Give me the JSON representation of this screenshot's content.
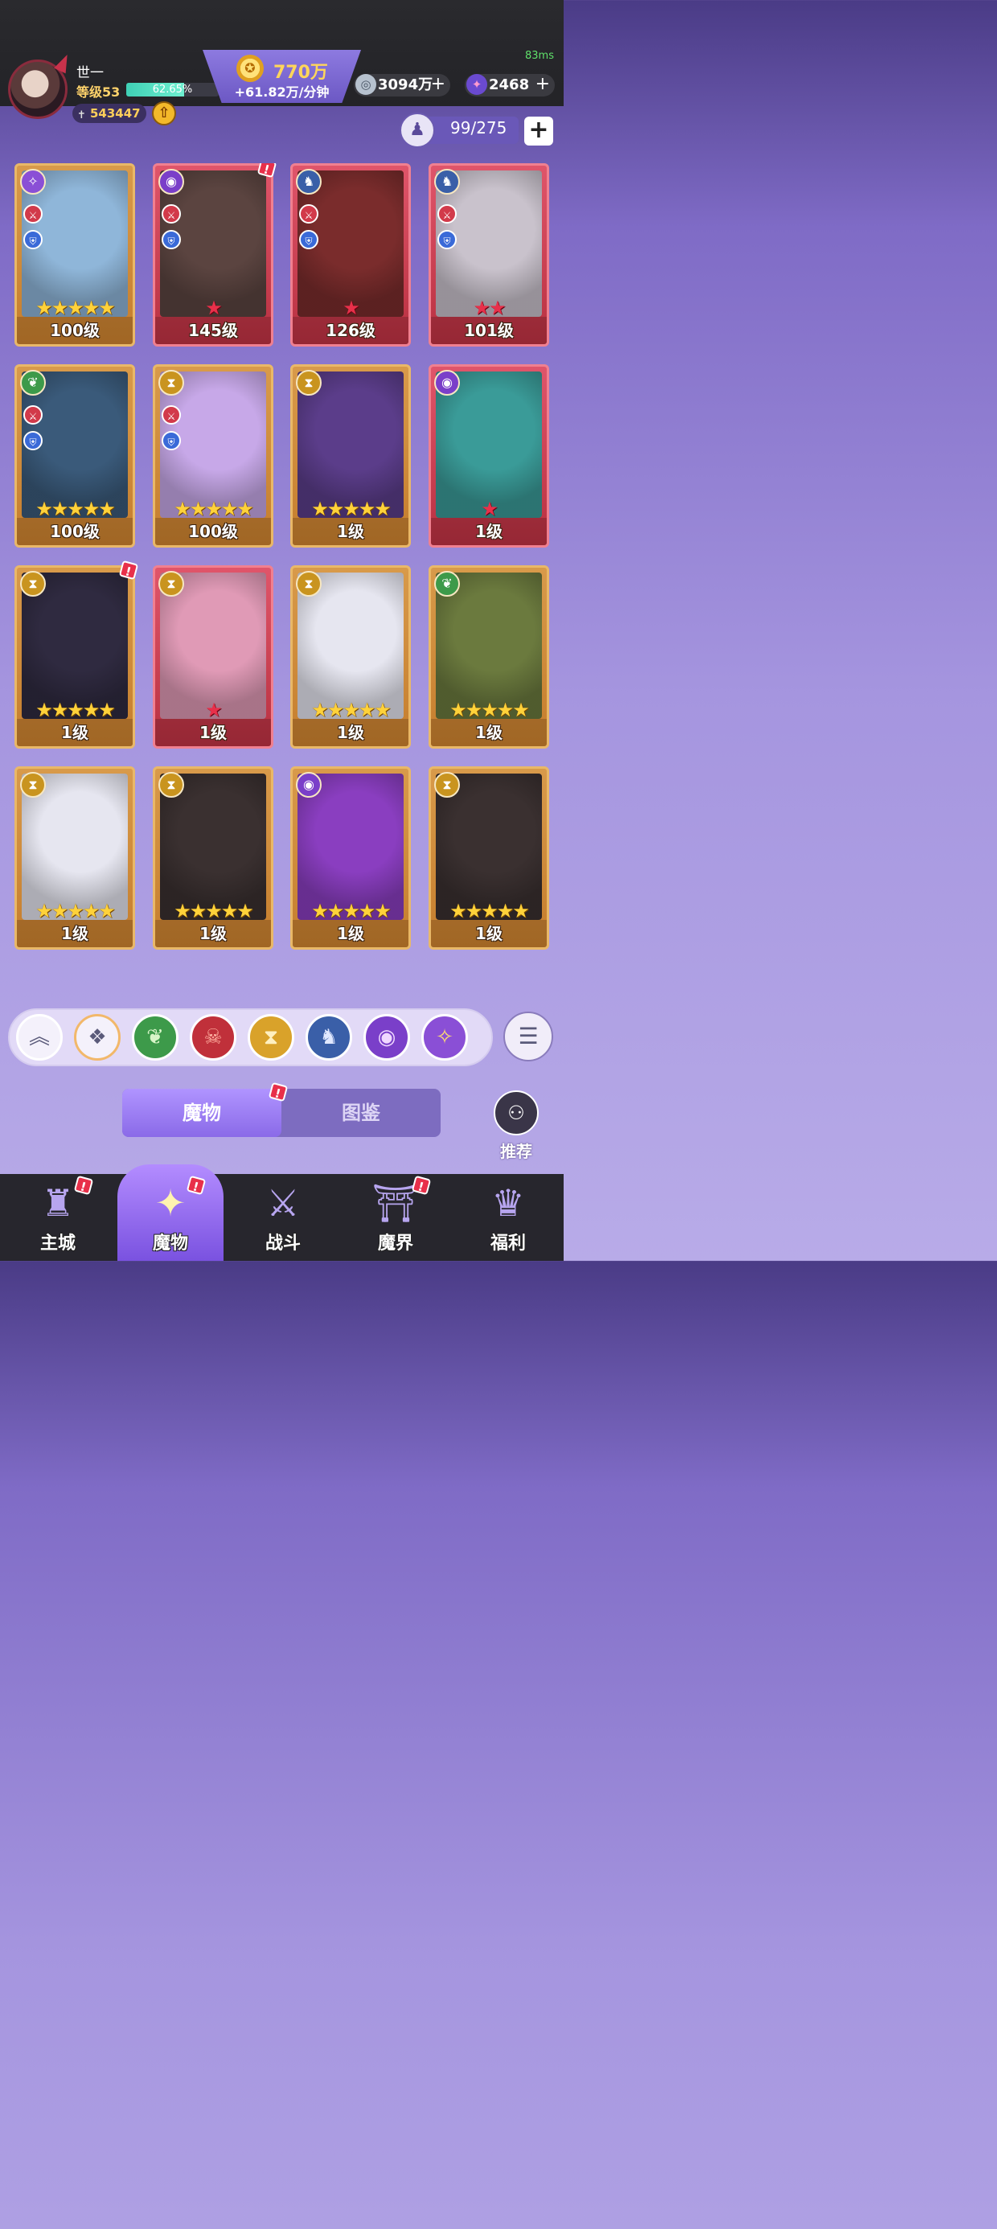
{
  "header": {
    "ping": "83ms",
    "player_name": "世一",
    "player_level": "等级53",
    "xp_percent_text": "62.65%",
    "xp_fraction": 0.6265,
    "power": "543447",
    "gold_amount": "770万",
    "gold_rate": "+61.82万/分钟",
    "currency1": "3094万",
    "currency2": "2468"
  },
  "capacity": {
    "text": "99/275"
  },
  "cards": [
    {
      "level": "100级",
      "frame": "gold",
      "stars": 5,
      "star_color": "gold",
      "element": "fairy",
      "element_color": "#8a4fd6",
      "atk": true,
      "def": true,
      "badge": false,
      "art": "#8fb6d9"
    },
    {
      "level": "145级",
      "frame": "red",
      "stars": 1,
      "star_color": "red",
      "element": "eye",
      "element_color": "#7a3fc9",
      "atk": true,
      "def": true,
      "badge": true,
      "art": "#5b4440"
    },
    {
      "level": "126级",
      "frame": "red",
      "stars": 1,
      "star_color": "red",
      "element": "dragon",
      "element_color": "#3a5fa8",
      "atk": true,
      "def": true,
      "badge": false,
      "art": "#7a2c2c"
    },
    {
      "level": "101级",
      "frame": "red",
      "stars": 2,
      "star_color": "red",
      "element": "dragon",
      "element_color": "#3a5fa8",
      "atk": true,
      "def": true,
      "badge": false,
      "art": "#c9c2cc"
    },
    {
      "level": "100级",
      "frame": "gold",
      "stars": 5,
      "star_color": "gold",
      "element": "leaf",
      "element_color": "#3d9a4a",
      "atk": true,
      "def": true,
      "badge": false,
      "art": "#3a5a7a"
    },
    {
      "level": "100级",
      "frame": "gold",
      "stars": 5,
      "star_color": "gold",
      "element": "hourglass",
      "element_color": "#c9941f",
      "atk": true,
      "def": true,
      "badge": false,
      "art": "#c7a8e8"
    },
    {
      "level": "1级",
      "frame": "gold",
      "stars": 5,
      "star_color": "gold",
      "element": "hourglass",
      "element_color": "#c9941f",
      "atk": false,
      "def": false,
      "badge": false,
      "art": "#5b3d8a"
    },
    {
      "level": "1级",
      "frame": "red",
      "stars": 1,
      "star_color": "red",
      "element": "eye",
      "element_color": "#7a3fc9",
      "atk": false,
      "def": false,
      "badge": false,
      "art": "#3a9b98"
    },
    {
      "level": "1级",
      "frame": "gold",
      "stars": 5,
      "star_color": "gold",
      "element": "hourglass",
      "element_color": "#c9941f",
      "atk": false,
      "def": false,
      "badge": true,
      "art": "#2f2a40"
    },
    {
      "level": "1级",
      "frame": "red",
      "stars": 1,
      "star_color": "red",
      "element": "hourglass",
      "element_color": "#c9941f",
      "atk": false,
      "def": false,
      "badge": false,
      "art": "#e09ab6"
    },
    {
      "level": "1级",
      "frame": "gold",
      "stars": 5,
      "star_color": "gold",
      "element": "hourglass",
      "element_color": "#c9941f",
      "atk": false,
      "def": false,
      "badge": false,
      "art": "#e6e6f0"
    },
    {
      "level": "1级",
      "frame": "gold",
      "stars": 5,
      "star_color": "gold",
      "element": "leaf",
      "element_color": "#3d9a4a",
      "atk": false,
      "def": false,
      "badge": false,
      "art": "#6b7a3e"
    },
    {
      "level": "1级",
      "frame": "gold",
      "stars": 5,
      "star_color": "gold",
      "element": "hourglass",
      "element_color": "#c9941f",
      "atk": false,
      "def": false,
      "badge": false,
      "art": "#e6e6f0"
    },
    {
      "level": "1级",
      "frame": "gold",
      "stars": 5,
      "star_color": "gold",
      "element": "hourglass",
      "element_color": "#c9941f",
      "atk": false,
      "def": false,
      "badge": false,
      "art": "#3a3030"
    },
    {
      "level": "1级",
      "frame": "gold",
      "stars": 5,
      "star_color": "gold",
      "element": "eye",
      "element_color": "#7a3fc9",
      "atk": false,
      "def": false,
      "badge": false,
      "art": "#8a3ec0"
    },
    {
      "level": "1级",
      "frame": "gold",
      "stars": 5,
      "star_color": "gold",
      "element": "hourglass",
      "element_color": "#c9941f",
      "atk": false,
      "def": false,
      "badge": false,
      "art": "#3a3030"
    }
  ],
  "filters": [
    {
      "name": "collapse",
      "icon": "︽",
      "color": "#f4f1fb",
      "fg": "#5a5a7a"
    },
    {
      "name": "all",
      "icon": "❖",
      "color": "#f4f1fb",
      "fg": "#5a5a7a"
    },
    {
      "name": "leaf",
      "icon": "❦",
      "color": "#3d9a4a",
      "fg": "#d8f5c8"
    },
    {
      "name": "demon",
      "icon": "☠",
      "color": "#c0303a",
      "fg": "#ffb0a0"
    },
    {
      "name": "hourglass",
      "icon": "⧗",
      "color": "#d9a22a",
      "fg": "#fff0c0"
    },
    {
      "name": "dragon",
      "icon": "♞",
      "color": "#3a5fa8",
      "fg": "#e0e8ff"
    },
    {
      "name": "eye",
      "icon": "◉",
      "color": "#7a3fc9",
      "fg": "#f0d8ff"
    },
    {
      "name": "fairy",
      "icon": "✧",
      "color": "#8a4fd6",
      "fg": "#ffe070"
    }
  ],
  "tabs": {
    "monsters": "魔物",
    "codex": "图鉴"
  },
  "recommend": "推荐",
  "nav": [
    {
      "label": "主城",
      "icon": "♜",
      "badge": true
    },
    {
      "label": "魔物",
      "icon": "✦",
      "badge": true
    },
    {
      "label": "战斗",
      "icon": "⚔",
      "badge": false
    },
    {
      "label": "魔界",
      "icon": "⛩",
      "badge": true
    },
    {
      "label": "福利",
      "icon": "♛",
      "badge": false
    }
  ]
}
